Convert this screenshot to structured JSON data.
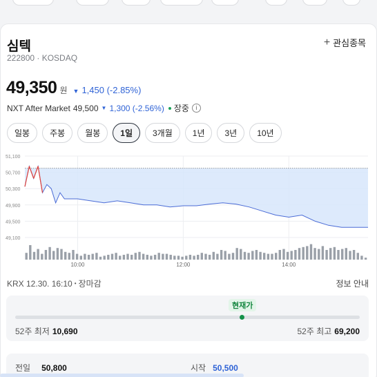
{
  "header": {
    "title": "심텍",
    "code": "222800 · KOSDAQ",
    "watch_label": "관심종목"
  },
  "price": {
    "value": "49,350",
    "unit": "원",
    "change": "1,450 (-2.85%)"
  },
  "after_market": {
    "label": "NXT After Market",
    "value": "49,500",
    "change": "1,300 (-2.56%)",
    "status": "장중"
  },
  "tabs": [
    "일봉",
    "주봉",
    "월봉",
    "1일",
    "3개월",
    "1년",
    "3년",
    "10년"
  ],
  "active_tab": "1일",
  "chart_data": {
    "type": "area",
    "y_ticks": [
      "51,100",
      "50,700",
      "50,300",
      "49,900",
      "49,500",
      "49,100"
    ],
    "x_ticks": [
      "10:00",
      "12:00",
      "14:00"
    ],
    "ylim": [
      49100,
      51100
    ],
    "reference_price": 50800,
    "times": [
      "09:00",
      "09:05",
      "09:10",
      "09:15",
      "09:20",
      "09:25",
      "09:30",
      "09:35",
      "09:40",
      "09:45",
      "09:50",
      "10:00",
      "10:15",
      "10:30",
      "10:45",
      "11:00",
      "11:15",
      "11:30",
      "11:45",
      "12:00",
      "12:15",
      "12:30",
      "12:45",
      "13:00",
      "13:15",
      "13:30",
      "13:45",
      "14:00",
      "14:15",
      "14:30",
      "14:45",
      "15:00",
      "15:15",
      "15:30"
    ],
    "price": [
      50350,
      50850,
      50550,
      50850,
      50200,
      50400,
      50300,
      49950,
      50200,
      50050,
      50050,
      50050,
      50000,
      49950,
      50000,
      49950,
      49900,
      49900,
      49850,
      49880,
      49880,
      49920,
      49950,
      49920,
      49850,
      49750,
      49650,
      49600,
      49650,
      49500,
      49400,
      49350,
      49350,
      49350
    ],
    "volume_bars": [
      0.35,
      0.75,
      0.4,
      0.55,
      0.3,
      0.5,
      0.65,
      0.45,
      0.6,
      0.55,
      0.4,
      0.35,
      0.5,
      0.3,
      0.2,
      0.3,
      0.25,
      0.3,
      0.35,
      0.15,
      0.2,
      0.25,
      0.3,
      0.35,
      0.2,
      0.25,
      0.3,
      0.25,
      0.35,
      0.4,
      0.3,
      0.25,
      0.2,
      0.25,
      0.35,
      0.3,
      0.3,
      0.25,
      0.2,
      0.2,
      0.15,
      0.2,
      0.25,
      0.2,
      0.25,
      0.35,
      0.3,
      0.25,
      0.4,
      0.3,
      0.5,
      0.45,
      0.3,
      0.35,
      0.6,
      0.55,
      0.4,
      0.35,
      0.45,
      0.5,
      0.4,
      0.35,
      0.3,
      0.3,
      0.35,
      0.5,
      0.55,
      0.4,
      0.45,
      0.5,
      0.6,
      0.65,
      0.7,
      0.8,
      0.6,
      0.55,
      0.7,
      0.5,
      0.6,
      0.65,
      0.5,
      0.55,
      0.6,
      0.45,
      0.5,
      0.35,
      0.2,
      0.1
    ]
  },
  "session": {
    "label": "KRX 12.30. 16:10",
    "status": "장마감",
    "info_link": "정보 안내"
  },
  "range": {
    "current_label": "현재가",
    "low_label": "52주 최저",
    "low_value": "10,690",
    "high_label": "52주 최고",
    "high_value": "69,200",
    "position": 0.663
  },
  "stats": {
    "prev_label": "전일",
    "prev_value": "50,800",
    "open_label": "시작",
    "open_value": "50,500"
  },
  "colors": {
    "down_blue": "#2f63d6",
    "up_red": "#e0403a",
    "area_fill": "#d7e6fb",
    "line": "#4a6bd6",
    "green": "#15914a"
  }
}
